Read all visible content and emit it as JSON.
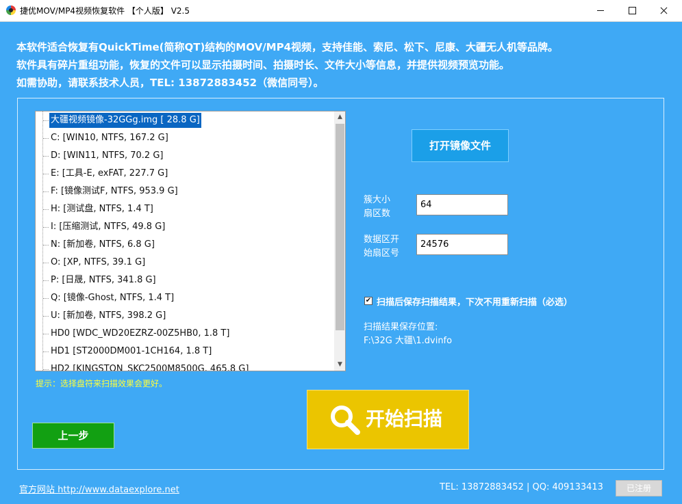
{
  "window": {
    "title": "捷优MOV/MP4视频恢复软件 【个人版】 V2.5"
  },
  "intro": {
    "line1": "本软件适合恢复有QuickTime(简称QT)结构的MOV/MP4视频，支持佳能、索尼、松下、尼康、大疆无人机等品牌。",
    "line2": "软件具有碎片重组功能，恢复的文件可以显示拍摄时间、拍摄时长、文件大小等信息，并提供视频预览功能。",
    "line3": "如需协助，请联系技术人员，TEL: 13872883452（微信同号）。"
  },
  "drives": {
    "selected_index": 0,
    "items": [
      "大疆视频镜像-32GGg.img  [ 28.8 G]",
      "C:  [WIN10, NTFS, 167.2 G]",
      "D:  [WIN11, NTFS, 70.2 G]",
      "E:  [工具-E, exFAT, 227.7 G]",
      "F:  [镜像测试F, NTFS, 953.9 G]",
      "H:  [测试盘, NTFS, 1.4 T]",
      "I:  [压缩测试, NTFS, 49.8 G]",
      "N:  [新加卷, NTFS, 6.8 G]",
      "O:  [XP, NTFS, 39.1 G]",
      "P:  [日晟, NTFS, 341.8 G]",
      "Q:  [镜像-Ghost, NTFS, 1.4 T]",
      "U:  [新加卷, NTFS, 398.2 G]",
      "HD0  [WDC_WD20EZRZ-00Z5HB0, 1.8 T]",
      "HD1  [ST2000DM001-1CH164, 1.8 T]",
      "HD2  [KINGSTON_SKC2500M8500G, 465.8 G]"
    ]
  },
  "hint": "提示：选择盘符来扫描效果会更好。",
  "open_image_button": "打开镜像文件",
  "fields": {
    "cluster_label": "簇大小\n扇区数",
    "cluster_value": "64",
    "data_start_label": "数据区开\n始扇区号",
    "data_start_value": "24576"
  },
  "save_results": {
    "checked": true,
    "check_mark": "✔",
    "label": "扫描后保存扫描结果，下次不用重新扫描（必选）",
    "location_label": "扫描结果保存位置:",
    "location_path": "F:\\32G  大疆\\1.dvinfo"
  },
  "start_scan_button": "开始扫描",
  "back_button": "上一步",
  "footer": {
    "website": "官方网站 http://www.dataexplore.net",
    "contact": "TEL: 13872883452  |  QQ: 409133413",
    "registered": "已注册"
  },
  "colors": {
    "background": "#3FA9F5",
    "selection": "#0A66C2",
    "open_button": "#1B9FE8",
    "scan_button": "#EBC500",
    "back_button": "#12A012",
    "hint_text": "#FFFF3A"
  },
  "icons": {
    "app": "app-logo-icon",
    "scan": "magnifier-icon",
    "scroll_up": "scroll-up-arrow-icon",
    "scroll_down": "scroll-down-arrow-icon"
  }
}
